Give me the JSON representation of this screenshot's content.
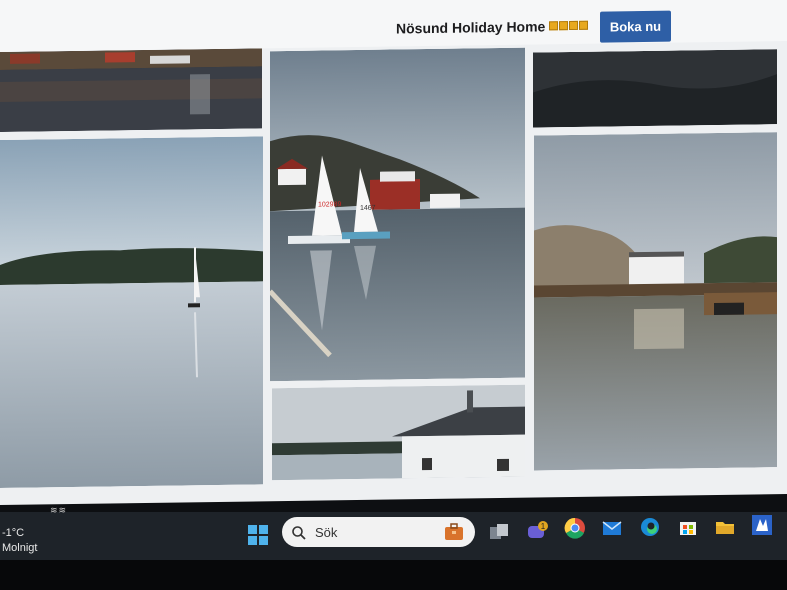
{
  "header": {
    "hotel_name": "Nösund Holiday Home",
    "star_count": 4,
    "book_button": "Boka nu"
  },
  "gallery": {
    "photos": [
      "harbor-reflection-thumb",
      "sailboat-bay",
      "two-sailboats-harbor",
      "boathouse-white",
      "dark-landscape-thumb",
      "rocky-shore-boathouse"
    ],
    "sail_numbers": [
      "102989",
      "1467"
    ]
  },
  "taskbar": {
    "weather_temp": "-1°C",
    "weather_desc": "Molnigt",
    "search_placeholder": "Sök",
    "chat_badge": "1",
    "icons": [
      "windows-start-icon",
      "search-icon",
      "file-explorer-briefcase-icon",
      "task-view-icon",
      "chat-icon",
      "chrome-icon",
      "mail-icon",
      "edge-icon",
      "store-icon",
      "folder-icon",
      "app-icon"
    ]
  },
  "colors": {
    "book_button": "#2e5fa6",
    "star": "#e7a81e",
    "taskbar": "#1e2329"
  }
}
